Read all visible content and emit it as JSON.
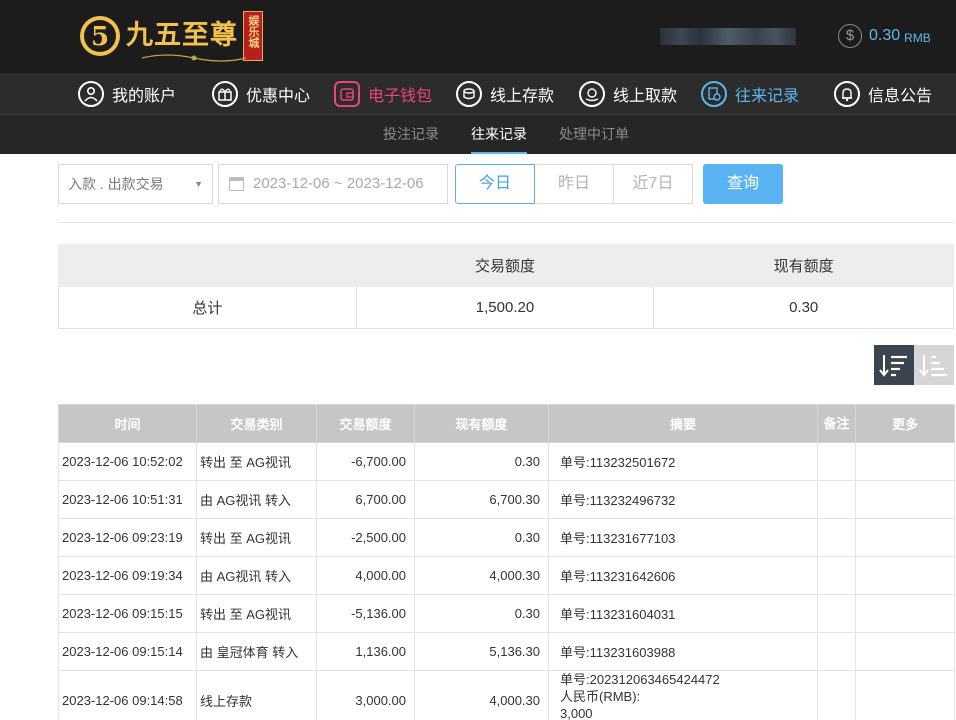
{
  "header": {
    "logo_text": "九五至尊",
    "logo_seal": "娱乐城",
    "balance_amount": "0.30",
    "balance_unit": "RMB"
  },
  "nav": [
    {
      "label": "我的账户",
      "icon": "user-icon"
    },
    {
      "label": "优惠中心",
      "icon": "gift-icon"
    },
    {
      "label": "电子钱包",
      "icon": "wallet-icon"
    },
    {
      "label": "线上存款",
      "icon": "deposit-icon"
    },
    {
      "label": "线上取款",
      "icon": "withdraw-icon"
    },
    {
      "label": "往来记录",
      "icon": "records-icon"
    },
    {
      "label": "信息公告",
      "icon": "bell-icon"
    }
  ],
  "subnav": [
    {
      "label": "投注记录"
    },
    {
      "label": "往来记录"
    },
    {
      "label": "处理中订单"
    }
  ],
  "filter": {
    "type_value": "入款 . 出款交易",
    "date_range": "2023-12-06 ~ 2023-12-06",
    "ranges": [
      "今日",
      "昨日",
      "近7日"
    ],
    "query_label": "查询"
  },
  "summary": {
    "headers": [
      "",
      "交易额度",
      "现有额度"
    ],
    "row": [
      "总计",
      "1,500.20",
      "0.30"
    ]
  },
  "records": {
    "headers": [
      "时间",
      "交易类别",
      "交易额度",
      "现有额度",
      "摘要",
      "备注",
      "更多"
    ],
    "rows": [
      [
        "2023-12-06 10:52:02",
        "转出 至 AG视讯",
        "-6,700.00",
        "0.30",
        "单号:113232501672",
        "",
        ""
      ],
      [
        "2023-12-06 10:51:31",
        "由 AG视讯 转入",
        "6,700.00",
        "6,700.30",
        "单号:113232496732",
        "",
        ""
      ],
      [
        "2023-12-06 09:23:19",
        "转出 至 AG视讯",
        "-2,500.00",
        "0.30",
        "单号:113231677103",
        "",
        ""
      ],
      [
        "2023-12-06 09:19:34",
        "由 AG视讯 转入",
        "4,000.00",
        "4,000.30",
        "单号:113231642606",
        "",
        ""
      ],
      [
        "2023-12-06 09:15:15",
        "转出 至 AG视讯",
        "-5,136.00",
        "0.30",
        "单号:113231604031",
        "",
        ""
      ],
      [
        "2023-12-06 09:15:14",
        "由 皇冠体育 转入",
        "1,136.00",
        "5,136.30",
        "单号:113231603988",
        "",
        ""
      ]
    ],
    "last_row": {
      "time": "2023-12-06 09:14:58",
      "type": "线上存款",
      "amount": "3,000.00",
      "balance": "4,000.30",
      "summary_lines": [
        "单号:202312063465424472",
        "人民币(RMB):",
        "3,000"
      ]
    }
  },
  "colors": {
    "accent_blue": "#5ab4f3",
    "pink": "#e9457a",
    "gold": "#f3c24d",
    "header_bg": "#1c1c1c"
  }
}
